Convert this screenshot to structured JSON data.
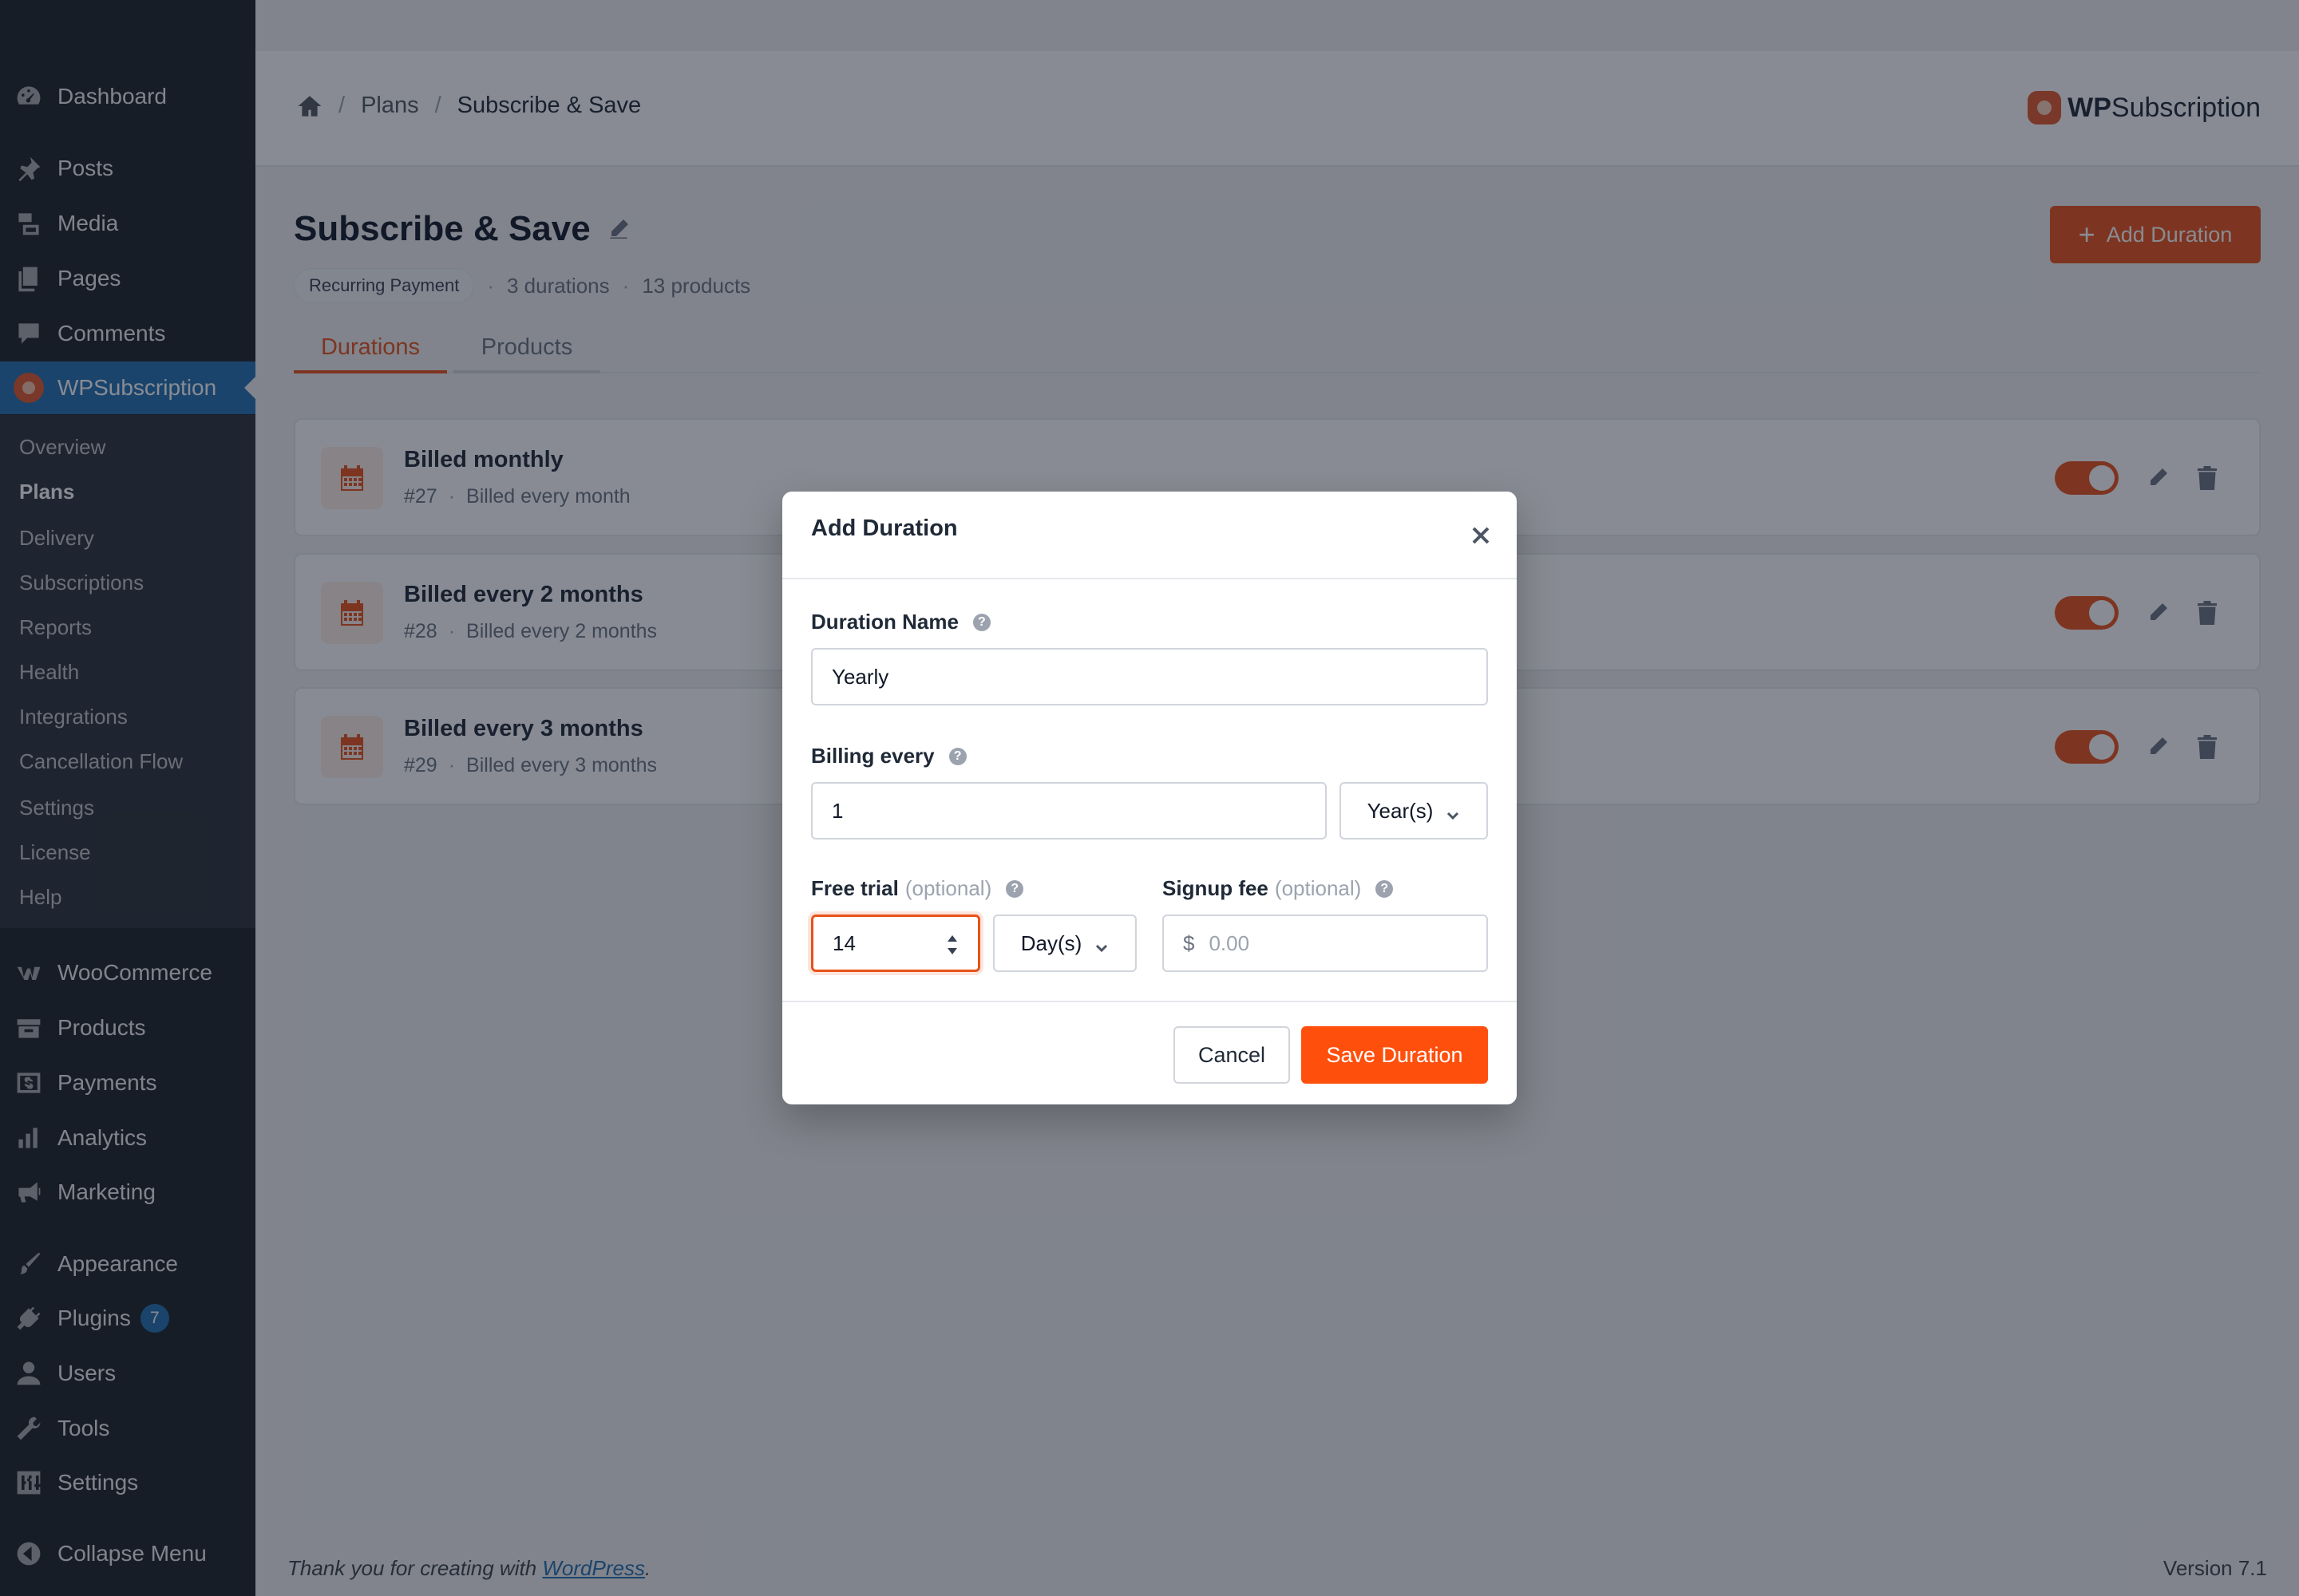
{
  "sidebar": {
    "top_items": [
      {
        "label": "Dashboard",
        "icon": "dashboard-icon"
      },
      {
        "label": "Posts",
        "icon": "pin-icon"
      },
      {
        "label": "Media",
        "icon": "media-icon"
      },
      {
        "label": "Pages",
        "icon": "pages-icon"
      },
      {
        "label": "Comments",
        "icon": "comment-icon"
      },
      {
        "label": "WPSubscription",
        "icon": "wpsubscription-logo-icon"
      }
    ],
    "submenu": [
      "Overview",
      "Plans",
      "Delivery",
      "Subscriptions",
      "Reports",
      "Health",
      "Integrations",
      "Cancellation Flow",
      "Settings",
      "License",
      "Help"
    ],
    "bottom_items": [
      {
        "label": "WooCommerce",
        "icon": "woocommerce-icon"
      },
      {
        "label": "Products",
        "icon": "archive-icon"
      },
      {
        "label": "Payments",
        "icon": "dollar-icon"
      },
      {
        "label": "Analytics",
        "icon": "bar-chart-icon"
      },
      {
        "label": "Marketing",
        "icon": "megaphone-icon"
      },
      {
        "label": "Appearance",
        "icon": "brush-icon"
      },
      {
        "label": "Plugins",
        "icon": "plug-icon",
        "badge": "7"
      },
      {
        "label": "Users",
        "icon": "user-icon"
      },
      {
        "label": "Tools",
        "icon": "wrench-icon"
      },
      {
        "label": "Settings",
        "icon": "sliders-icon"
      },
      {
        "label": "Collapse Menu",
        "icon": "collapse-arrow-icon"
      }
    ]
  },
  "header": {
    "breadcrumb": [
      "Plans",
      "Subscribe & Save"
    ],
    "brand_bold": "WP",
    "brand_rest": "Subscription"
  },
  "plan": {
    "title": "Subscribe & Save",
    "pill": "Recurring Payment",
    "durations_count": "3 durations",
    "products_count": "13 products",
    "add_button": "Add Duration",
    "tabs": [
      "Durations",
      "Products"
    ]
  },
  "durations": [
    {
      "title": "Billed monthly",
      "id": "#27",
      "desc": "Billed every month",
      "enabled": true
    },
    {
      "title": "Billed every 2 months",
      "id": "#28",
      "desc": "Billed every 2 months",
      "enabled": true
    },
    {
      "title": "Billed every 3 months",
      "id": "#29",
      "desc": "Billed every 3 months",
      "enabled": true
    }
  ],
  "footer": {
    "thanks_prefix": "Thank you for creating with ",
    "wp_link": "WordPress",
    "thanks_suffix": ".",
    "version": "Version 7.1"
  },
  "modal": {
    "title": "Add Duration",
    "duration_name_label": "Duration Name",
    "duration_name_value": "Yearly",
    "billing_every_label": "Billing every",
    "billing_every_value": "1",
    "billing_unit": "Year(s)",
    "free_trial_label": "Free trial",
    "optional": "(optional)",
    "free_trial_value": "14",
    "free_trial_unit": "Day(s)",
    "signup_fee_label": "Signup fee",
    "currency": "$",
    "signup_fee_placeholder": "0.00",
    "cancel": "Cancel",
    "save": "Save Duration"
  },
  "colors": {
    "accent": "#e8521a",
    "save_button": "#ff4f0c",
    "wp_sidebar": "#1d2327",
    "wp_blue": "#2271b1"
  }
}
